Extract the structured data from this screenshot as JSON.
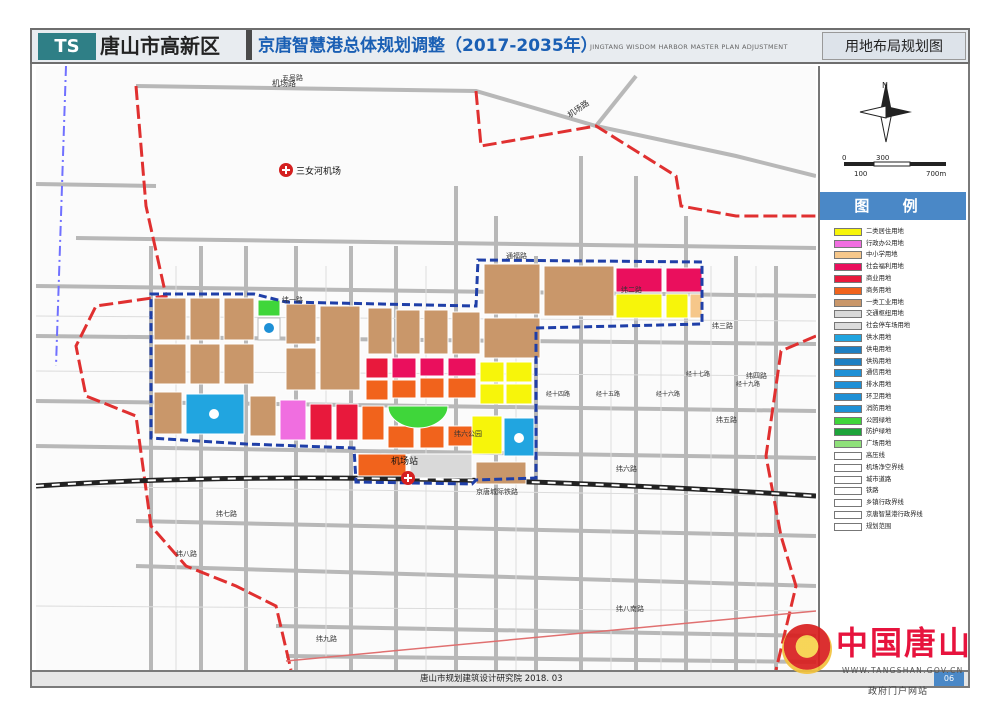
{
  "header": {
    "logo_text": "TS",
    "district": "唐山市高新区",
    "plan_title": "京唐智慧港总体规划调整（2017-2035年）",
    "plan_title_en": "JINGTANG WISDOM HARBOR MASTER PLAN ADJUSTMENT",
    "map_title": "用地布局规划图"
  },
  "scale_bar": {
    "labels": [
      "0",
      "100",
      "300",
      "700m"
    ]
  },
  "legend": {
    "heading": "图 例",
    "items": [
      {
        "label": "二类居住用地",
        "color": "#f7f50a"
      },
      {
        "label": "行政办公用地",
        "color": "#f06ee0"
      },
      {
        "label": "中小学用地",
        "color": "#f6c78a"
      },
      {
        "label": "社会福利用地",
        "color": "#ea0f5d"
      },
      {
        "label": "商业用地",
        "color": "#e8193c"
      },
      {
        "label": "商务用地",
        "color": "#f1631c"
      },
      {
        "label": "一类工业用地",
        "color": "#c9976a"
      },
      {
        "label": "交通枢纽用地",
        "color": "#d9d9d9"
      },
      {
        "label": "社会停车场用地",
        "color": "#dcdcdc"
      },
      {
        "label": "供水用地",
        "color": "#21a5e0"
      },
      {
        "label": "供电用地",
        "color": "#1e7fc2"
      },
      {
        "label": "供热用地",
        "color": "#1e7fc2"
      },
      {
        "label": "通信用地",
        "color": "#1e90d6"
      },
      {
        "label": "排水用地",
        "color": "#1e90d6"
      },
      {
        "label": "环卫用地",
        "color": "#1e90d6"
      },
      {
        "label": "消防用地",
        "color": "#1e90d6"
      },
      {
        "label": "公园绿地",
        "color": "#3fd63a"
      },
      {
        "label": "防护绿地",
        "color": "#1da43a"
      },
      {
        "label": "广场用地",
        "color": "#8fe07a"
      },
      {
        "label": "高压线",
        "color": "#ffffff"
      },
      {
        "label": "机场净空界线",
        "color": "#ffffff"
      },
      {
        "label": "城市道路",
        "color": "#ffffff"
      },
      {
        "label": "铁路",
        "color": "#ffffff"
      },
      {
        "label": "乡镇行政界线",
        "color": "#ffffff"
      },
      {
        "label": "京唐智慧港行政界线",
        "color": "#ffffff"
      },
      {
        "label": "规划范围",
        "color": "#ffffff"
      }
    ]
  },
  "map": {
    "labels": {
      "wusan_road": "五号路",
      "airport_road_1": "机场路",
      "airport_road_2": "机场路",
      "airport": "三女河机场",
      "station": "机场站",
      "railway": "京唐城际铁路",
      "weiyi_road": "纬一路",
      "weier_road": "纬二路",
      "weisan_road": "纬三路",
      "weisi_road": "纬四路",
      "weiwu_road": "纬五路",
      "weiliu_road": "纬六路",
      "weiqi_road": "纬七路",
      "weiba_road": "纬八路",
      "weijiu_road": "纬九路",
      "weibanan_road": "纬八南路",
      "weiliu_gc": "纬六公园",
      "jingshisi_road": "经十四路",
      "jingshiwu_road": "经十五路",
      "jingshiliu_road": "经十六路",
      "jingshiqi_road": "经十七路",
      "jingshijiu_road": "经十九路",
      "tongfu_road": "通福路"
    }
  },
  "footer": {
    "institute": "唐山市规划建筑设计研究院  2018. 03",
    "page": "06"
  },
  "watermark": {
    "text": "中国唐山",
    "url": "WWW.TANGSHAN.GOV.CN",
    "sub": "政府门户网站"
  }
}
